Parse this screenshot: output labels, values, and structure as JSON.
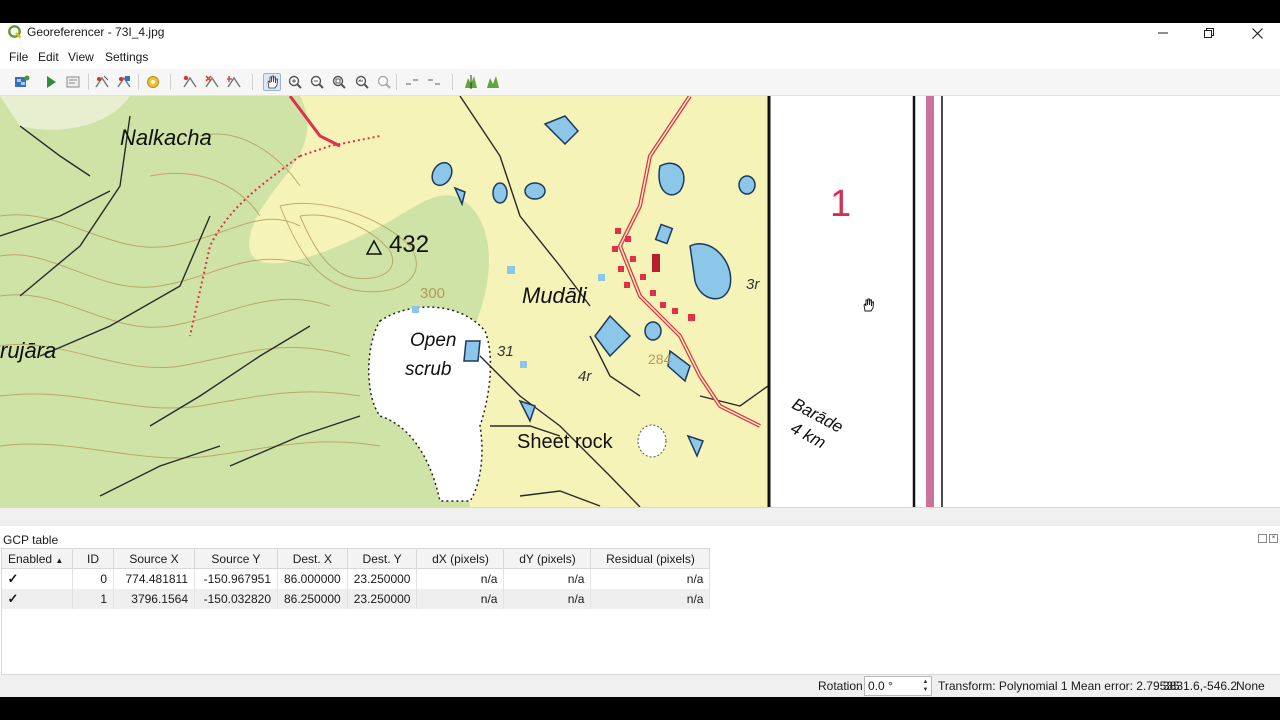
{
  "window": {
    "title": "Georeferencer - 73I_4.jpg"
  },
  "menu": {
    "items": [
      "File",
      "Edit",
      "View",
      "Settings"
    ]
  },
  "toolbar": {
    "buttons": [
      "open-raster-icon",
      "start-georeferencing-icon",
      "generate-gdal-script-icon",
      "load-gcp-points-icon",
      "save-gcp-points-icon",
      "transformation-settings-icon",
      "add-point-icon",
      "delete-point-icon",
      "move-gcp-point-icon",
      "pan-icon",
      "zoom-in-icon",
      "zoom-out-icon",
      "zoom-to-layer-icon",
      "zoom-last-icon",
      "zoom-next-icon",
      "link-georeferencer-to-qgis-icon",
      "link-qgis-to-georeferencer-icon",
      "local-histogram-stretch-icon",
      "full-histogram-stretch-icon"
    ]
  },
  "map": {
    "labels": {
      "nalkacha": "Nalkacha",
      "elev432": "432",
      "mudali": "Mudāli",
      "rujara": "rujāra",
      "open": "Open",
      "scrub": "scrub",
      "sheetrock": "Sheet rock",
      "c300": "300",
      "c284": "284",
      "num31": "31",
      "num4r": "4r",
      "num3r": "3r",
      "sheetnum": "1",
      "barade": "Barāde",
      "km": "4 km"
    }
  },
  "gcp": {
    "title": "GCP table",
    "columns": [
      "Enabled",
      "ID",
      "Source X",
      "Source Y",
      "Dest. X",
      "Dest. Y",
      "dX (pixels)",
      "dY (pixels)",
      "Residual (pixels)"
    ],
    "rows": [
      {
        "enabled": true,
        "id": "0",
        "source_x": "774.481811",
        "source_y": "-150.967951",
        "dest_x": "86.000000",
        "dest_y": "23.250000",
        "dx": "n/a",
        "dy": "n/a",
        "residual": "n/a"
      },
      {
        "enabled": true,
        "id": "1",
        "source_x": "3796.1564",
        "source_y": "-150.032820",
        "dest_x": "86.250000",
        "dest_y": "23.250000",
        "dx": "n/a",
        "dy": "n/a",
        "residual": "n/a"
      }
    ]
  },
  "status": {
    "rotation_label": "Rotation",
    "rotation_value": "0.0 °",
    "transform_text": "Transform: Polynomial 1 Mean error: 2.79535",
    "coords": "3831.6,-546.2",
    "crs": "None"
  },
  "colors": {
    "map_green": "#cfe3a6",
    "map_yellow": "#f6f3b8",
    "water_blue": "#8cc6e8",
    "contour_brown": "#b49a5a",
    "road_red": "#e0304a",
    "frame_pink": "#c9739a"
  }
}
